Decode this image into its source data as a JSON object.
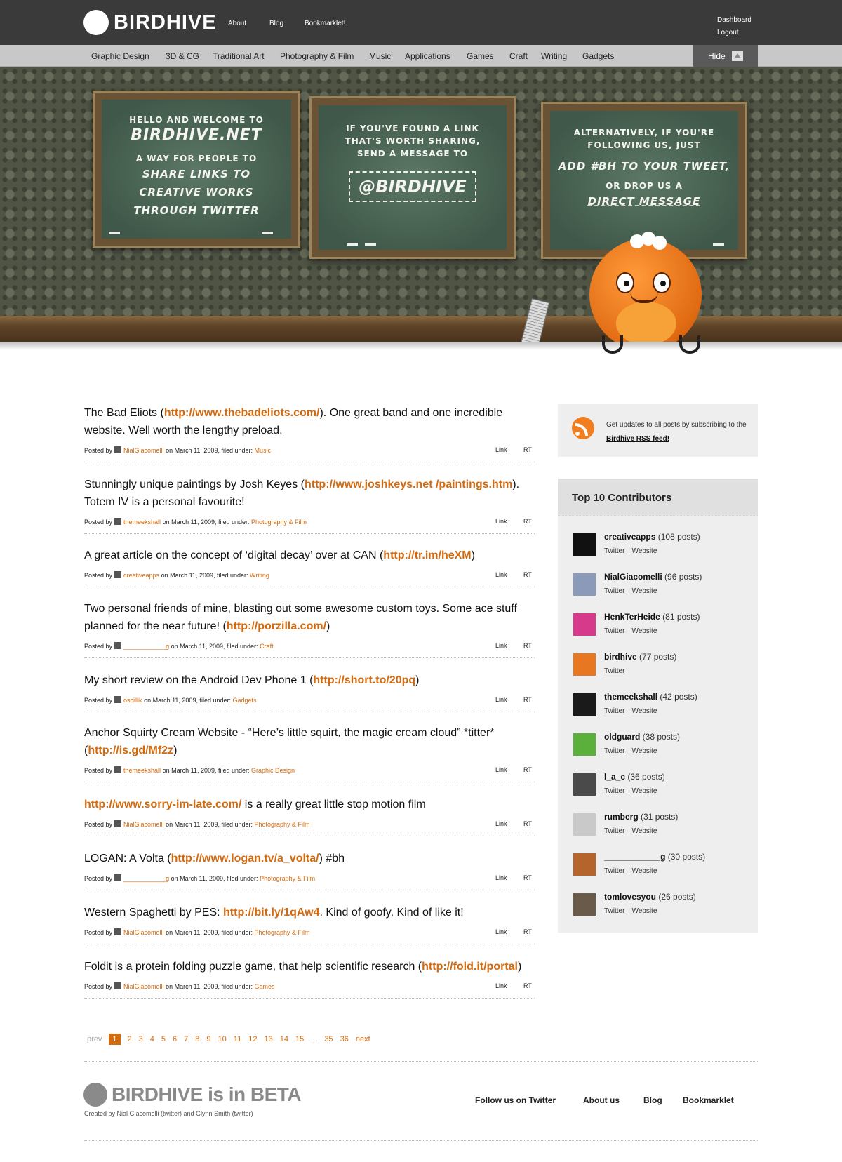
{
  "header": {
    "logo_text": "BIRDHIVE",
    "nav": [
      "About",
      "Blog",
      "Bookmarklet!"
    ],
    "user_links": [
      "Dashboard",
      "Logout"
    ]
  },
  "categories": [
    "Graphic Design",
    "3D & CG",
    "Traditional Art",
    "Photography & Film",
    "Music",
    "Applications",
    "Games",
    "Craft",
    "Writing",
    "Gadgets"
  ],
  "hide_label": "Hide",
  "hero": {
    "board1": {
      "line1": "Hello and welcome to",
      "site": "Birdhive.net",
      "line2": "a way for people to",
      "line3": "share links to",
      "line4": "creative works",
      "line5": "through Twitter"
    },
    "board2": {
      "line1": "If you've found a link",
      "line2": "that's worth sharing,",
      "line3": "send a message to",
      "handle": "@Birdhive"
    },
    "board3": {
      "line1": "Alternatively, if you're",
      "line2": "following us, just",
      "line3": "add #bh to your tweet,",
      "line4": "or drop us a",
      "line5": "direct message"
    }
  },
  "posts": [
    {
      "pre": "The Bad Eliots (",
      "url": "http://www.thebadeliots.com/",
      "post": "). One great band and one incredible website. Well worth the lengthy preload.",
      "author": "NialGiacomelli",
      "date": "on March 11, 2009, filed under:",
      "category": "Music"
    },
    {
      "pre": "Stunningly unique paintings by Josh Keyes (",
      "url": "http://www.joshkeys.net /paintings.htm",
      "post": "). Totem IV is a personal favourite!",
      "author": "themeekshall",
      "date": "on March 11, 2009, filed under:",
      "category": "Photography & Film"
    },
    {
      "pre": "A great article on the concept of ‘digital decay’ over at CAN (",
      "url": "http://tr.im/heXM",
      "post": ")",
      "author": "creativeapps",
      "date": "on March 11, 2009, filed under:",
      "category": "Writing"
    },
    {
      "pre": "Two personal friends of mine, blasting out some awesome custom toys. Some ace stuff planned for the near future! (",
      "url": "http://porzilla.com/",
      "post": ")",
      "author": "____________g",
      "date": "on March 11, 2009, filed under:",
      "category": "Craft"
    },
    {
      "pre": "My short review on the Android Dev Phone 1 (",
      "url": "http://short.to/20pq",
      "post": ")",
      "author": "oscillik",
      "date": "on March 11, 2009, filed under:",
      "category": "Gadgets"
    },
    {
      "pre": "Anchor Squirty Cream Website - “Here’s little squirt, the magic cream cloud” *titter* (",
      "url": "http://is.gd/Mf2z",
      "post": ")",
      "author": "themeekshall",
      "date": "on March 11, 2009, filed under:",
      "category": "Graphic Design"
    },
    {
      "pre": "",
      "url": "http://www.sorry-im-late.com/",
      "post": " is a really great little stop motion film",
      "author": "NialGiacomelli",
      "date": "on March 11, 2009, filed under:",
      "category": "Photography & Film"
    },
    {
      "pre": "LOGAN: A Volta (",
      "url": "http://www.logan.tv/a_volta/",
      "post": ") #bh",
      "author": "____________g",
      "date": "on March 11, 2009, filed under:",
      "category": "Photography & Film"
    },
    {
      "pre": "Western Spaghetti by PES: ",
      "url": "http://bit.ly/1qAw4",
      "post": ". Kind of goofy. Kind of like it!",
      "author": "NialGiacomelli",
      "date": "on March 11, 2009, filed under:",
      "category": "Photography & Film"
    },
    {
      "pre": "Foldit is a protein folding puzzle game, that help scientific research (",
      "url": "http://fold.it/portal",
      "post": ")",
      "author": "NialGiacomelli",
      "date": "on March 11, 2009, filed under:",
      "category": "Games"
    }
  ],
  "post_meta": {
    "posted_by": "Posted by",
    "link": "Link",
    "rt": "RT"
  },
  "pager": {
    "prev": "prev",
    "next": "next",
    "pages": [
      "1",
      "2",
      "3",
      "4",
      "5",
      "6",
      "7",
      "8",
      "9",
      "10",
      "11",
      "12",
      "13",
      "14",
      "15",
      "...",
      "35",
      "36"
    ]
  },
  "rss": {
    "text": "Get updates to all posts by subscribing to the",
    "link": "Birdhive RSS feed!"
  },
  "contributors_title": "Top 10 Contributors",
  "contributors": [
    {
      "name": "creativeapps",
      "count": "(108 posts)",
      "links": [
        "Twitter",
        "Website"
      ],
      "avatar_color": "#111111"
    },
    {
      "name": "NialGiacomelli",
      "count": "(96 posts)",
      "links": [
        "Twitter",
        "Website"
      ],
      "avatar_color": "#8a9ab8"
    },
    {
      "name": "HenkTerHeide",
      "count": "(81 posts)",
      "links": [
        "Twitter",
        "Website"
      ],
      "avatar_color": "#d63a8a"
    },
    {
      "name": "birdhive",
      "count": "(77 posts)",
      "links": [
        "Twitter"
      ],
      "avatar_color": "#e87722"
    },
    {
      "name": "themeekshall",
      "count": "(42 posts)",
      "links": [
        "Twitter",
        "Website"
      ],
      "avatar_color": "#1a1a1a"
    },
    {
      "name": "oldguard",
      "count": "(38 posts)",
      "links": [
        "Twitter",
        "Website"
      ],
      "avatar_color": "#5ab03a"
    },
    {
      "name": "l_a_c",
      "count": "(36 posts)",
      "links": [
        "Twitter",
        "Website"
      ],
      "avatar_color": "#4a4a4a"
    },
    {
      "name": "rumberg",
      "count": "(31 posts)",
      "links": [
        "Twitter",
        "Website"
      ],
      "avatar_color": "#c9c9c9"
    },
    {
      "name": "____________g",
      "count": "(30 posts)",
      "links": [
        "Twitter",
        "Website"
      ],
      "avatar_color": "#b5652c"
    },
    {
      "name": "tomlovesyou",
      "count": "(26 posts)",
      "links": [
        "Twitter",
        "Website"
      ],
      "avatar_color": "#6a5a4a"
    }
  ],
  "footer": {
    "title": "BIRDHIVE is in BETA",
    "credit": "Created by Nial Giacomelli (twitter) and Glynn Smith (twitter)",
    "nav": [
      "Follow us on Twitter",
      "About us",
      "Blog",
      "Bookmarklet"
    ]
  },
  "colors": {
    "accent": "#d46a0e",
    "topbar": "#3a3a3a",
    "catbar": "#c8c8c8"
  }
}
